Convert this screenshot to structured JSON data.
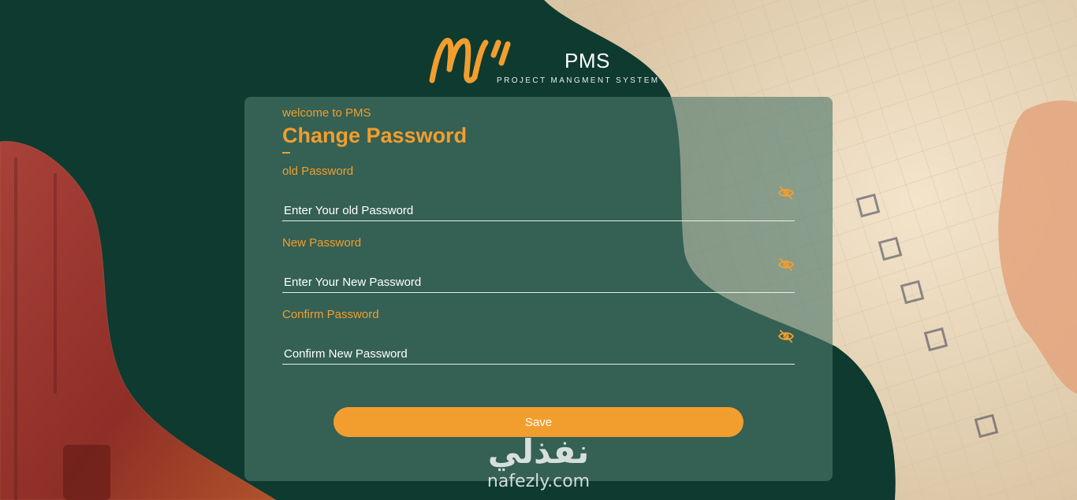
{
  "brand": {
    "name": "PMS",
    "tagline": "PROJECT MANGMENT SYSTEM"
  },
  "form": {
    "welcome": "welcome to PMS",
    "title": "Change Password",
    "fields": [
      {
        "label": "old Password",
        "placeholder": "Enter Your old Password",
        "icon": "eye-slash-icon"
      },
      {
        "label": "New Password",
        "placeholder": "Enter Your New Password",
        "icon": "eye-slash-icon"
      },
      {
        "label": "Confirm Password",
        "placeholder": "Confirm New Password",
        "icon": "eye-slash-icon"
      }
    ],
    "save_label": "Save"
  },
  "watermark": {
    "arabic": "نفذلي",
    "latin": "nafezly.com"
  },
  "colors": {
    "background": "#0e3a2f",
    "accent": "#f29e2e",
    "card": "#4e786c"
  }
}
